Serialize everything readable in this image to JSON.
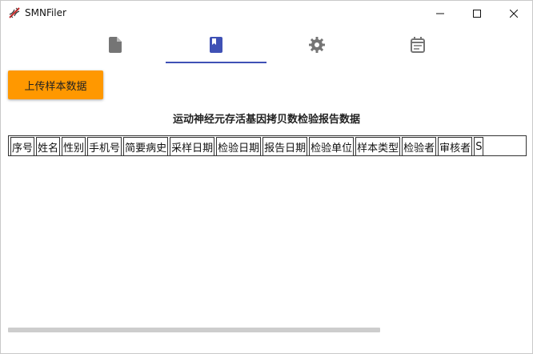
{
  "window": {
    "title": "SMNFiler",
    "controls": {
      "minimize": "—",
      "maximize": "☐",
      "close": "✕"
    }
  },
  "tabs": [
    {
      "icon": "document-icon",
      "selected": false
    },
    {
      "icon": "book-icon",
      "selected": true
    },
    {
      "icon": "gear-icon",
      "selected": false
    },
    {
      "icon": "calendar-icon",
      "selected": false
    }
  ],
  "upload_button": {
    "label": "上传样本数据"
  },
  "report": {
    "title": "运动神经元存活基因拷贝数检验报告数据",
    "columns": [
      "序号",
      "姓名",
      "性别",
      "手机号",
      "简要病史",
      "采样日期",
      "检验日期",
      "报告日期",
      "检验单位",
      "样本类型",
      "检验者",
      "审核者",
      "S"
    ]
  },
  "colors": {
    "accent": "#3f51b5",
    "tab_icon": "#757575",
    "upload_button_bg": "#ff9800",
    "scrollbar": "#cdcdcd"
  }
}
